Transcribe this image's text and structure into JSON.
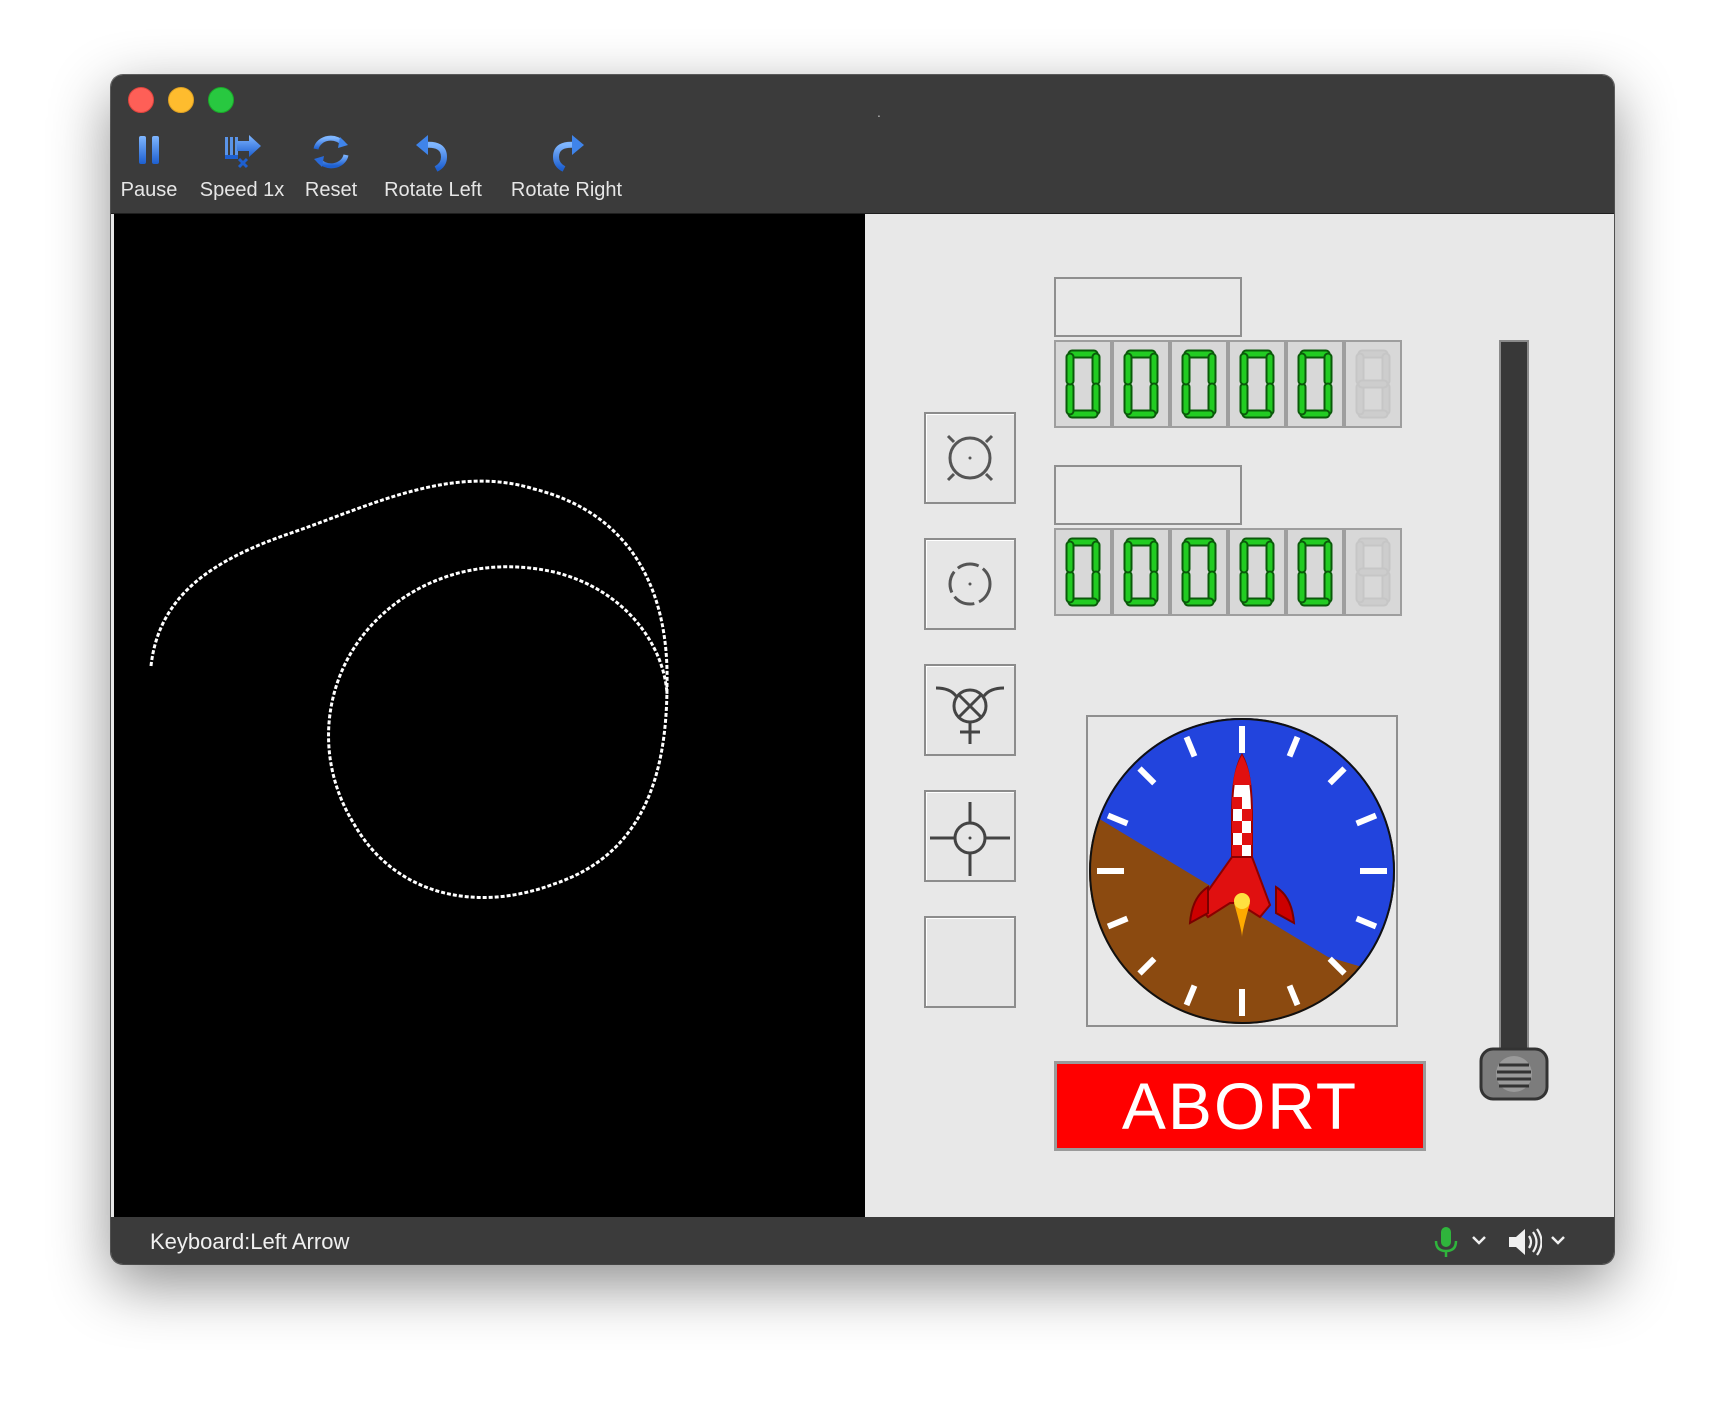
{
  "window": {
    "title": "."
  },
  "toolbar": {
    "pause_label": "Pause",
    "speed_label": "Speed 1x",
    "reset_label": "Reset",
    "rotate_left_label": "Rotate Left",
    "rotate_right_label": "Rotate Right"
  },
  "panel": {
    "counter1": {
      "digits": [
        "0",
        "0",
        "0",
        "0",
        "0",
        "8"
      ],
      "label": ""
    },
    "counter2": {
      "digits": [
        "0",
        "0",
        "0",
        "0",
        "0",
        "8"
      ],
      "label": ""
    },
    "mode_buttons": [
      "circle-orbit-icon",
      "dashed-circle-icon",
      "crossed-target-icon",
      "crosshair-icon",
      "empty-button"
    ],
    "abort_label": "ABORT",
    "throttle_level": 0
  },
  "status": {
    "keyboard_text": "Keyboard:Left Arrow"
  },
  "colors": {
    "digit_on": "#22cc22",
    "sky": "#2244dd",
    "ground": "#8b4a10",
    "abort": "#ff0000"
  }
}
